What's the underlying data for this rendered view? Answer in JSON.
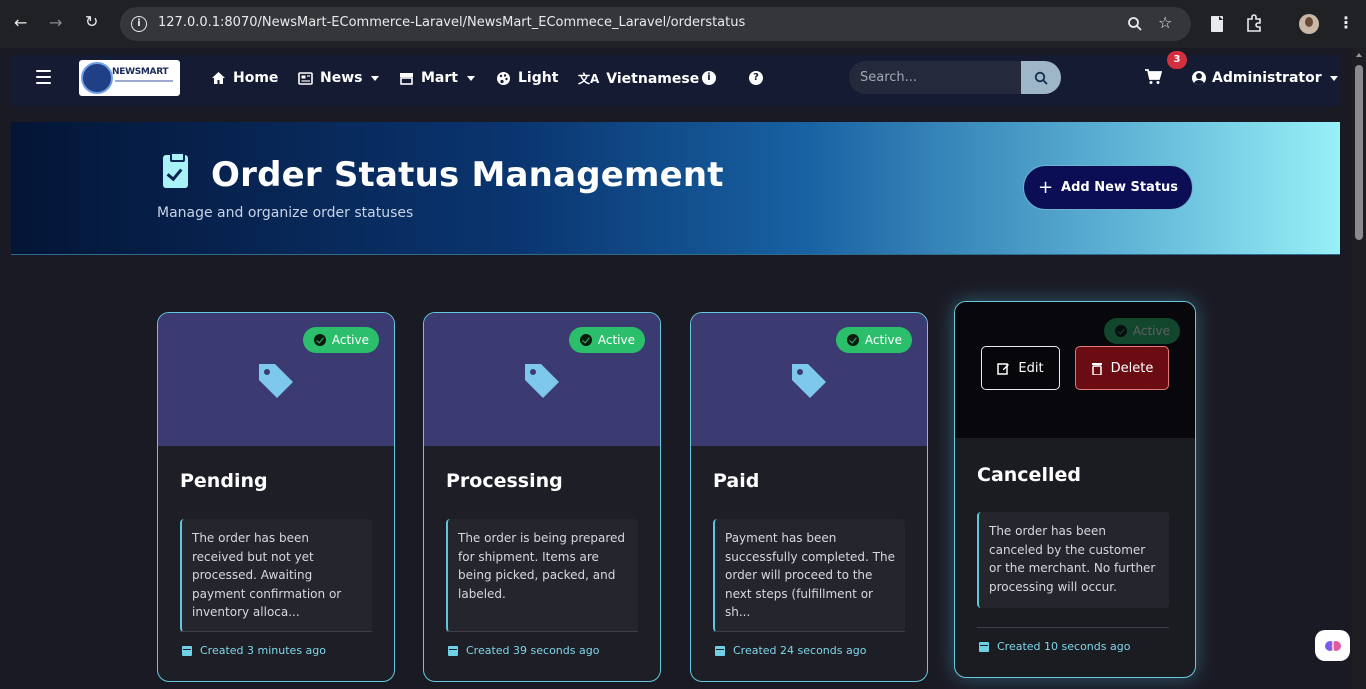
{
  "browser": {
    "url": "127.0.0.1:8070/NewsMart-ECommerce-Laravel/NewsMart_ECommece_Laravel/orderstatus"
  },
  "navbar": {
    "logo_text": "NEWSMART",
    "items": [
      {
        "label": "Home",
        "icon": "home-icon"
      },
      {
        "label": "News",
        "icon": "newspaper-icon",
        "dropdown": true
      },
      {
        "label": "Mart",
        "icon": "store-icon",
        "dropdown": true
      },
      {
        "label": "Light",
        "icon": "palette-icon"
      },
      {
        "label": "Vietnamese",
        "icon": "language-icon"
      }
    ],
    "search_placeholder": "Search...",
    "cart_count": "3",
    "user": "Administrator"
  },
  "hero": {
    "title": "Order Status Management",
    "subtitle": "Manage and organize order statuses",
    "add_button": "Add New Status"
  },
  "cards": [
    {
      "name": "Pending",
      "status": "Active",
      "description": "The order has been received but not yet processed. Awaiting payment confirmation or inventory alloca...",
      "created": "Created 3 minutes ago"
    },
    {
      "name": "Processing",
      "status": "Active",
      "description": "The order is being prepared for shipment. Items are being picked, packed, and labeled.",
      "created": "Created 39 seconds ago"
    },
    {
      "name": "Paid",
      "status": "Active",
      "description": "Payment has been successfully completed. The order will proceed to the next steps (fulfillment or sh...",
      "created": "Created 24 seconds ago"
    },
    {
      "name": "Cancelled",
      "status": "Active",
      "description": "The order has been canceled by the customer or the merchant. No further processing will occur.",
      "created": "Created 10 seconds ago",
      "edit_label": "Edit",
      "delete_label": "Delete"
    }
  ],
  "colors": {
    "accent": "#65c8dc",
    "active_badge": "#2bbf6c",
    "card_header": "#3b3a71",
    "delete": "#6b0b12",
    "add_button": "#0b0e55"
  }
}
